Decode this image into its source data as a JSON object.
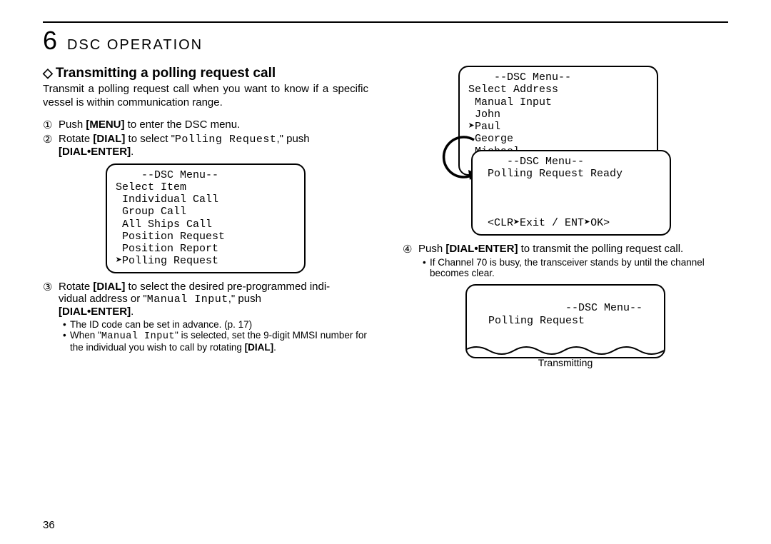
{
  "chapter": {
    "num": "6",
    "title": "DSC OPERATION"
  },
  "section": {
    "diamond": "◇",
    "title": "Transmitting a polling request call"
  },
  "intro": "Transmit a polling request call when you want to know if a specific vessel is within communication range.",
  "steps": {
    "s1": {
      "num": "①",
      "pre": "Push ",
      "key": "[MENU]",
      "post": " to enter the DSC menu."
    },
    "s2": {
      "num": "②",
      "pre": "Rotate ",
      "key1": "[DIAL]",
      "mid": " to select \"",
      "lcd": "Polling Request",
      "post": ",\" push ",
      "key2": "[DIAL•ENTER]",
      "tail": "."
    },
    "s3": {
      "num": "③",
      "line1a": "Rotate ",
      "line1b": "[DIAL]",
      "line1c": " to select the desired pre-programmed indi-",
      "line2a": "vidual    address    or    \"",
      "lcd": "Manual   Input",
      "line2b": ",\"    push",
      "line3key": "[DIAL•ENTER]",
      "line3tail": "."
    },
    "s4": {
      "num": "④",
      "pre": "Push ",
      "key": "[DIAL•ENTER]",
      "post": " to transmit the polling request call."
    }
  },
  "sub_bullets": {
    "b1": "The ID code can be set in advance. (p. 17)",
    "b2a": "When \"",
    "b2lcd": "Manual Input",
    "b2b": "\" is selected, set the 9-digit MMSI number for the individual you wish to call by rotating ",
    "b2key": "[DIAL]",
    "b2tail": "."
  },
  "s4_bullet": "If Channel 70 is busy, the transceiver stands by until the channel becomes clear.",
  "screens": {
    "menu1": "    --DSC Menu--\nSelect Item\n Individual Call\n Group Call\n All Ships Call\n Position Request\n Position Report\n➤Polling Request",
    "addr": "    --DSC Menu--\nSelect Address\n Manual Input\n John\n➤Paul\n George\n Michael\n <CLR➤Exit / ENT➤OK>",
    "ready": "    --DSC Menu--\n Polling Request Ready\n\n\n\n <CLR➤Exit / ENT➤OK>",
    "tx": "    --DSC Menu--\n  Polling Request"
  },
  "caption_tx": "Transmitting",
  "page_number": "36"
}
